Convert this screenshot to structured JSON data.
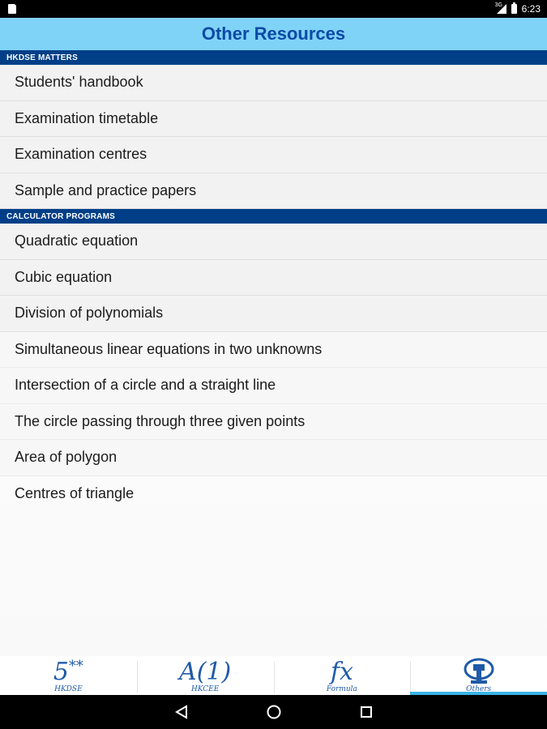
{
  "status_bar": {
    "time": "6:23",
    "network": "3G",
    "icons": [
      "sd-card-icon",
      "signal-icon",
      "battery-icon"
    ]
  },
  "header": {
    "title": "Other Resources"
  },
  "sections": [
    {
      "title": "HKDSE MATTERS",
      "items": [
        "Students' handbook",
        "Examination timetable",
        "Examination centres",
        "Sample and practice papers"
      ]
    },
    {
      "title": "CALCULATOR PROGRAMS",
      "items": [
        "Quadratic equation",
        "Cubic equation",
        "Division of polynomials",
        "Simultaneous linear equations in two unknowns",
        "Intersection of a circle and a straight line",
        "The circle passing through three given points",
        "Area of polygon",
        "Centres of triangle"
      ]
    }
  ],
  "tabs": [
    {
      "glyph": "5",
      "glyph_sup": "**",
      "label": "HKDSE",
      "active": false
    },
    {
      "glyph": "A(1)",
      "label": "HKCEE",
      "active": false
    },
    {
      "glyph": "fx",
      "label": "Formula",
      "active": false
    },
    {
      "icon": "tools-icon",
      "label": "Others",
      "active": true
    }
  ],
  "colors": {
    "header_bg": "#7fd3f7",
    "header_text": "#0d4aa6",
    "section_bg": "#003f87",
    "tab_active": "#39b4e6",
    "tab_glyph": "#1f5aa8"
  },
  "nav_bar": {
    "buttons": [
      "back-icon",
      "home-icon",
      "recents-icon"
    ]
  }
}
